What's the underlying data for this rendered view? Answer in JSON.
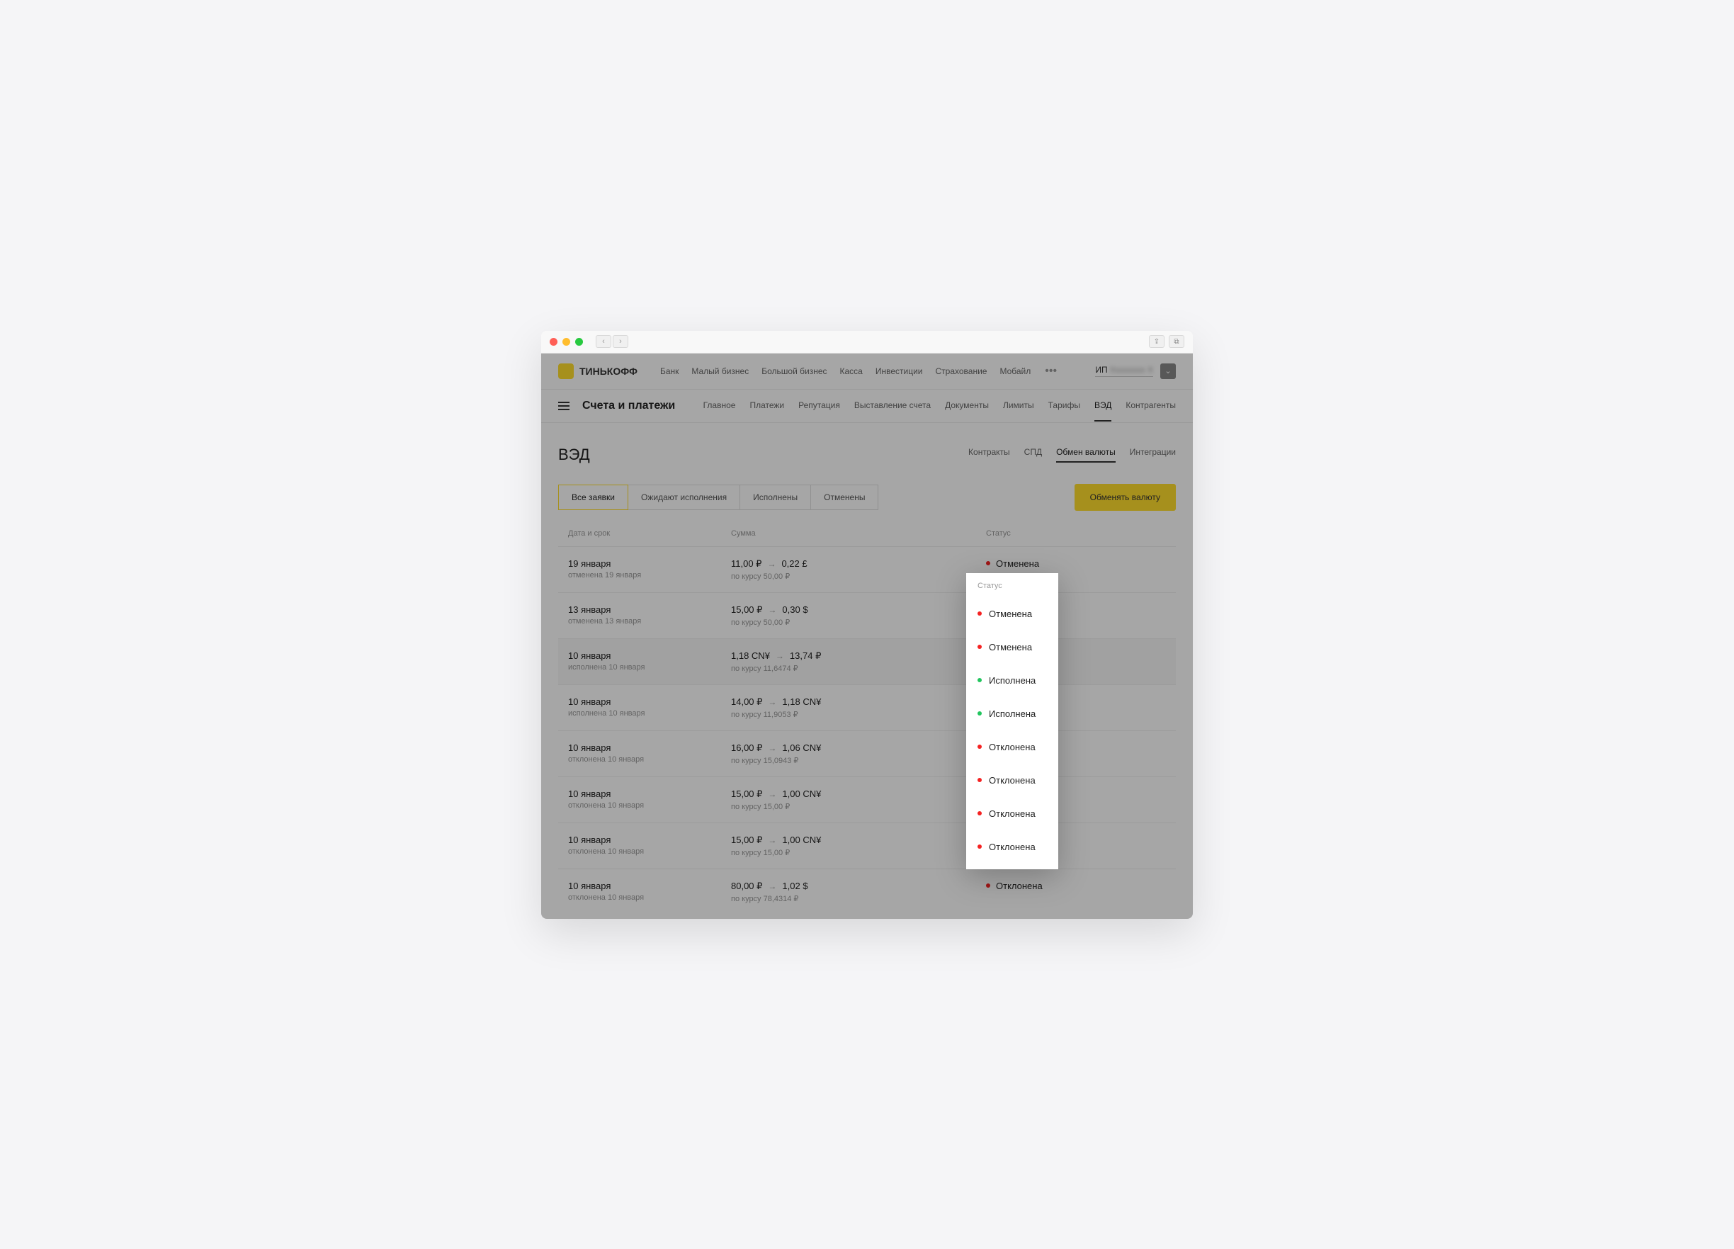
{
  "brand": "ТИНЬКОФФ",
  "top_nav": [
    "Банк",
    "Малый бизнес",
    "Большой бизнес",
    "Касса",
    "Инвестиции",
    "Страхование",
    "Мобайл"
  ],
  "user_prefix": "ИП",
  "user_name_blurred": "Хххххххх X",
  "sub_title": "Счета и платежи",
  "sub_nav": [
    "Главное",
    "Платежи",
    "Репутация",
    "Выставление счета",
    "Документы",
    "Лимиты",
    "Тарифы",
    "ВЭД",
    "Контрагенты"
  ],
  "sub_nav_active": 7,
  "page_title": "ВЭД",
  "page_tabs": [
    "Контракты",
    "СПД",
    "Обмен валюты",
    "Интеграции"
  ],
  "page_tabs_active": 2,
  "filters": [
    "Все заявки",
    "Ожидают исполнения",
    "Исполнены",
    "Отменены"
  ],
  "filters_active": 0,
  "action_button": "Обменять валюту",
  "columns": {
    "date": "Дата и срок",
    "sum": "Сумма",
    "status": "Статус"
  },
  "popup_header": "Статус",
  "rows": [
    {
      "date": "19 января",
      "date_sub": "отменена 19 января",
      "from": "11,00 ₽",
      "to": "0,22 £",
      "rate": "по курсу 50,00 ₽",
      "status": "Отменена",
      "dot": "red"
    },
    {
      "date": "13 января",
      "date_sub": "отменена 13 января",
      "from": "15,00 ₽",
      "to": "0,30 $",
      "rate": "по курсу 50,00 ₽",
      "status": "Отменена",
      "dot": "red"
    },
    {
      "date": "10 января",
      "date_sub": "исполнена 10 января",
      "from": "1,18 CN¥",
      "to": "13,74 ₽",
      "rate": "по курсу 11,6474 ₽",
      "status": "Исполнена",
      "dot": "green",
      "highlighted": true
    },
    {
      "date": "10 января",
      "date_sub": "исполнена 10 января",
      "from": "14,00 ₽",
      "to": "1,18 CN¥",
      "rate": "по курсу 11,9053 ₽",
      "status": "Исполнена",
      "dot": "green"
    },
    {
      "date": "10 января",
      "date_sub": "отклонена 10 января",
      "from": "16,00 ₽",
      "to": "1,06 CN¥",
      "rate": "по курсу 15,0943 ₽",
      "status": "Отклонена",
      "dot": "red"
    },
    {
      "date": "10 января",
      "date_sub": "отклонена 10 января",
      "from": "15,00 ₽",
      "to": "1,00 CN¥",
      "rate": "по курсу 15,00 ₽",
      "status": "Отклонена",
      "dot": "red"
    },
    {
      "date": "10 января",
      "date_sub": "отклонена 10 января",
      "from": "15,00 ₽",
      "to": "1,00 CN¥",
      "rate": "по курсу 15,00 ₽",
      "status": "Отклонена",
      "dot": "red"
    },
    {
      "date": "10 января",
      "date_sub": "отклонена 10 января",
      "from": "80,00 ₽",
      "to": "1,02 $",
      "rate": "по курсу 78,4314 ₽",
      "status": "Отклонена",
      "dot": "red"
    }
  ]
}
